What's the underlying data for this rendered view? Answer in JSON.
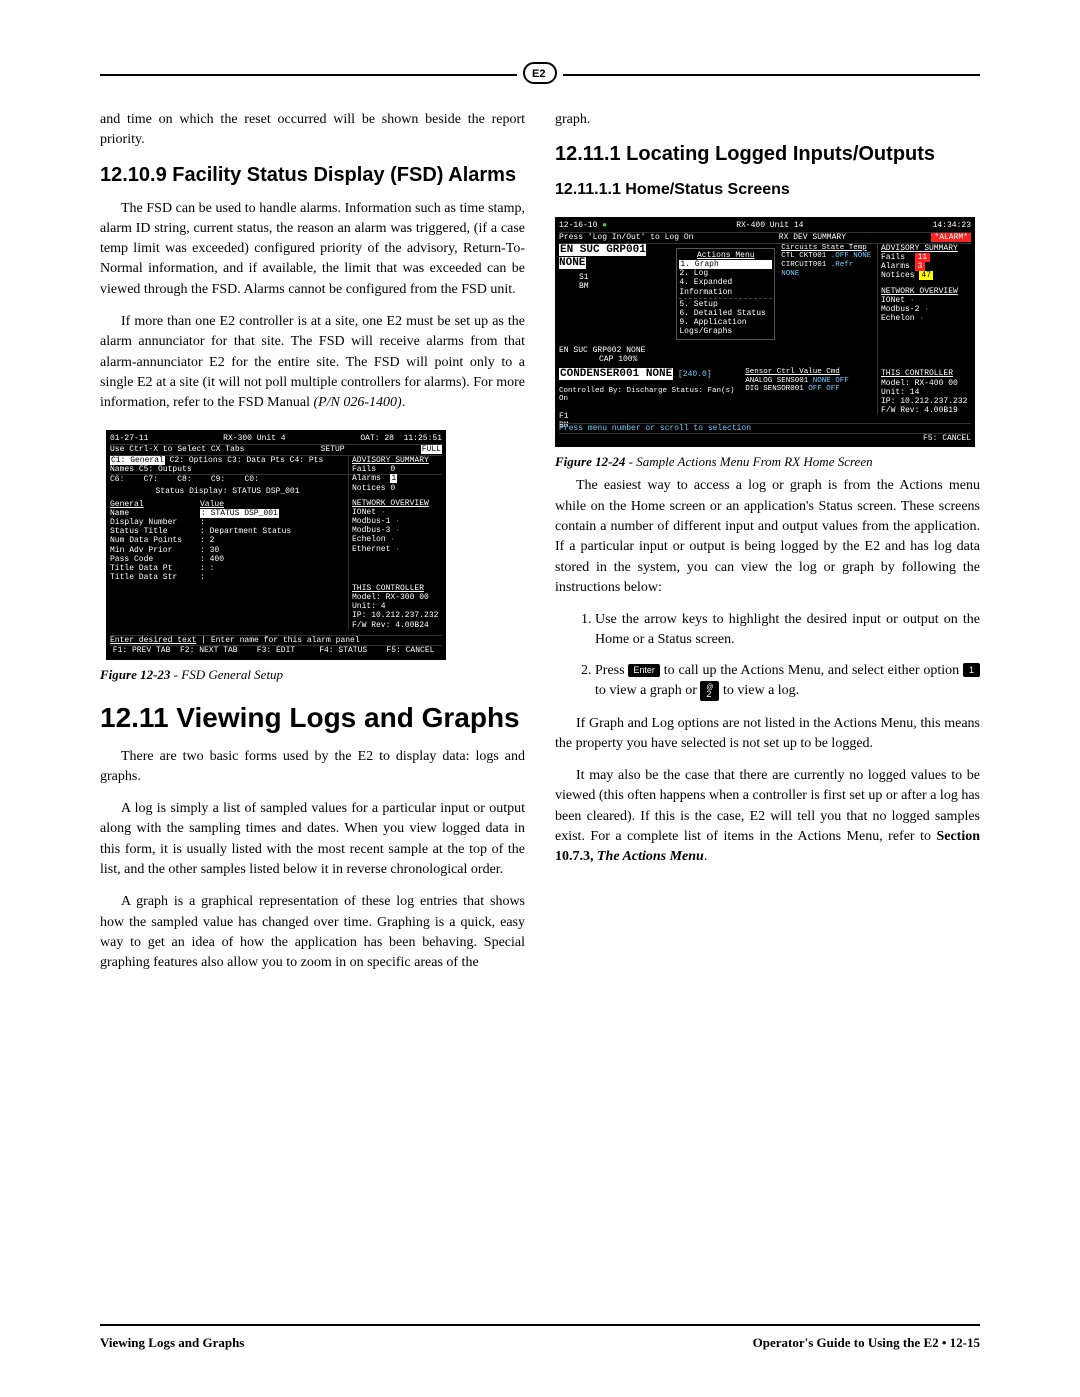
{
  "lead_paragraph": "and time on which the reset occurred will be shown beside the report priority.",
  "sec1": {
    "heading": "12.10.9 Facility Status Display (FSD) Alarms",
    "p1": "The FSD can be used to handle alarms. Information such as time stamp, alarm ID string, current status, the reason an alarm was triggered, (if a case temp limit was exceeded) configured priority of the advisory, Return-To-Normal information, and if available, the limit that was exceeded can be viewed through the FSD. Alarms cannot be configured from the FSD unit.",
    "p2_a": "If more than one E2 controller is at a site, one E2 must be set up as the alarm annunciator for that site. The FSD will receive alarms from that alarm-annunciator E2 for the entire site. The FSD will point only to a single E2 at a site (it will not poll multiple controllers for alarms). For more information, refer to the FSD Manual ",
    "p2_b": "(P/N 026-1400)",
    "p2_c": "."
  },
  "fig23": {
    "label": "Figure 12-23",
    "text": " - FSD General Setup",
    "date": "01-27-11",
    "hint": "Use Ctrl-X to Select CX Tabs",
    "center_top": "RX-300 Unit 4",
    "center_mode": "SETUP",
    "oat": "OAT:  28",
    "time": "11:25:51",
    "full": "FULL",
    "tabs": [
      "C1: General",
      "C2: Options",
      "C3: Data Pts",
      "C4: Pts Names",
      "C5: Outputs",
      "C6:",
      "C7:",
      "C8:",
      "C9:",
      "C0:"
    ],
    "status_line": "Status Display: STATUS DSP_001",
    "fields": [
      [
        "General",
        "Value"
      ],
      [
        "Name",
        ": STATUS DSP_001"
      ],
      [
        "Display Number",
        ":"
      ],
      [
        "Status Title",
        ": Department Status"
      ],
      [
        "Num Data Points",
        ":   2"
      ],
      [
        "Min Adv Prior",
        ":  30"
      ],
      [
        "Pass Code",
        ": 400"
      ],
      [
        "Title Data Pt",
        ":            :"
      ],
      [
        "Title Data Str",
        ":"
      ]
    ],
    "adv_header": "ADVISORY SUMMARY",
    "adv": [
      [
        "Fails",
        "0"
      ],
      [
        "Alarms",
        "1"
      ],
      [
        "Notices",
        "0"
      ]
    ],
    "net_header": "NETWORK OVERVIEW",
    "net": [
      [
        "IONet",
        "·"
      ],
      [
        "Modbus-1",
        "·"
      ],
      [
        "Modbus-3",
        "·"
      ],
      [
        "Echelon",
        "·"
      ],
      [
        "Ethernet",
        "·"
      ]
    ],
    "ctrl_header": "THIS CONTROLLER",
    "ctrl": [
      "Model: RX-300  00",
      "Unit: 4",
      "IP: 10.212.237.232",
      "F/W Rev: 4.00B24"
    ],
    "prompt_a": "Enter desired text",
    "prompt_b": "Enter name for this alarm panel",
    "fbar": [
      "F1: PREV TAB",
      "F2: NEXT TAB",
      "F3: EDIT",
      "F4: STATUS",
      "F5: CANCEL"
    ]
  },
  "sec2": {
    "heading": "12.11 Viewing Logs and Graphs",
    "p1": "There are two basic forms used by the E2 to display data: logs and graphs.",
    "p2": "A log is simply a list of sampled values for a particular input or output along with the sampling times and dates. When you view logged data in this form, it is usually listed with the most recent sample at the top of the list, and the other samples listed below it in reverse chronological order.",
    "p3": "A graph is a graphical representation of these log entries that shows how the sampled value has changed over time. Graphing is a quick, easy way to get an idea of how the application has been behaving. Special graphing features also allow you to zoom in on specific areas of the"
  },
  "col2_lead": "graph.",
  "sec3": {
    "heading": "12.11.1 Locating Logged Inputs/Outputs",
    "sub": "12.11.1.1 Home/Status Screens"
  },
  "fig24": {
    "label": "Figure 12-24",
    "text": " - Sample Actions Menu From RX Home Screen",
    "date": "12-16-10",
    "hint": "Press 'Log In/Out' to Log On",
    "center_top": "RX-400 Unit 14",
    "center_mode": "RX DEV SUMMARY",
    "time": "14:34:23",
    "alarm": "*ALARM*",
    "grp1": "EN SUC GRP001   NONE",
    "s1": "S1",
    "bm": "BM",
    "menu_title": "Actions Menu",
    "menu": [
      "1.  Graph",
      "2.  Log",
      "4.  Expanded Information",
      "",
      "5.  Setup",
      "6.  Detailed Status",
      "9.  Application Logs/Graphs"
    ],
    "circuits_hdr": "Circuits    State Temp",
    "circuits": [
      [
        "CTL CKT001",
        ".OFF  NONE"
      ],
      [
        "CIRCUIT001",
        ".Refr NONE"
      ]
    ],
    "grp2_line": "EN SUC GRP002   NONE",
    "grp2_cap": "CAP    100%",
    "cond": "CONDENSER001    NONE",
    "cond_val": "[240.0]",
    "cond_ctrl": "Controlled By: Discharge    Status: Fan(s) On",
    "sensor_hdr": "Sensor Ctrl    Value  Cmd",
    "sensors": [
      [
        "ANALOG SENS001",
        "NONE   OFF"
      ],
      [
        "DIG SENSOR001",
        "OFF    OFF"
      ]
    ],
    "f_left": [
      "F1",
      "BM"
    ],
    "scroll_msg": "Press menu number or scroll to selection",
    "f5": "F5: CANCEL",
    "adv_header": "ADVISORY SUMMARY",
    "adv": [
      [
        "Fails",
        "11"
      ],
      [
        "Alarms",
        "3"
      ],
      [
        "Notices",
        "47"
      ]
    ],
    "net_header": "NETWORK OVERVIEW",
    "net": [
      [
        "IONet",
        "·"
      ],
      [
        "Modbus-2",
        "·"
      ],
      [
        "Echelon",
        "·"
      ]
    ],
    "ctrl_header": "THIS CONTROLLER",
    "ctrl": [
      "Model: RX-400  00",
      "Unit: 14",
      "IP: 10.212.237.232",
      "F/W Rev: 4.00B19"
    ]
  },
  "sec3_body": {
    "p1": "The easiest way to access a log or graph is from the Actions menu while on the Home screen or an application's Status screen. These screens contain a number of different input and output values from the application. If a particular input or output is being logged by the E2 and has log data stored in the system, you can view the log or graph by following the instructions below:",
    "step1": "Use the arrow keys to highlight the desired input or output on the Home or a Status screen.",
    "step2_a": "Press ",
    "key_enter": "Enter",
    "step2_b": " to call up the Actions Menu, and select either option ",
    "key1": "1",
    "step2_c": " to view a graph or ",
    "key2_top": "@",
    "key2": "2",
    "step2_d": " to view a log.",
    "p2": "If Graph and Log options are not listed in the Actions Menu, this means the property you have selected is not set up to be logged.",
    "p3_a": "It may also be the case that there are currently no logged values to be viewed (this often happens when a controller is first set up or after a log has been cleared). If this is the case, E2 will tell you that no logged samples exist. For a complete list of items in the Actions Menu, refer to ",
    "p3_b": "Section 10.7.3, ",
    "p3_c": "The Actions Menu",
    "p3_d": "."
  },
  "footer": {
    "left": "Viewing Logs and Graphs",
    "right": "Operator's Guide to Using the E2 • 12-15"
  }
}
